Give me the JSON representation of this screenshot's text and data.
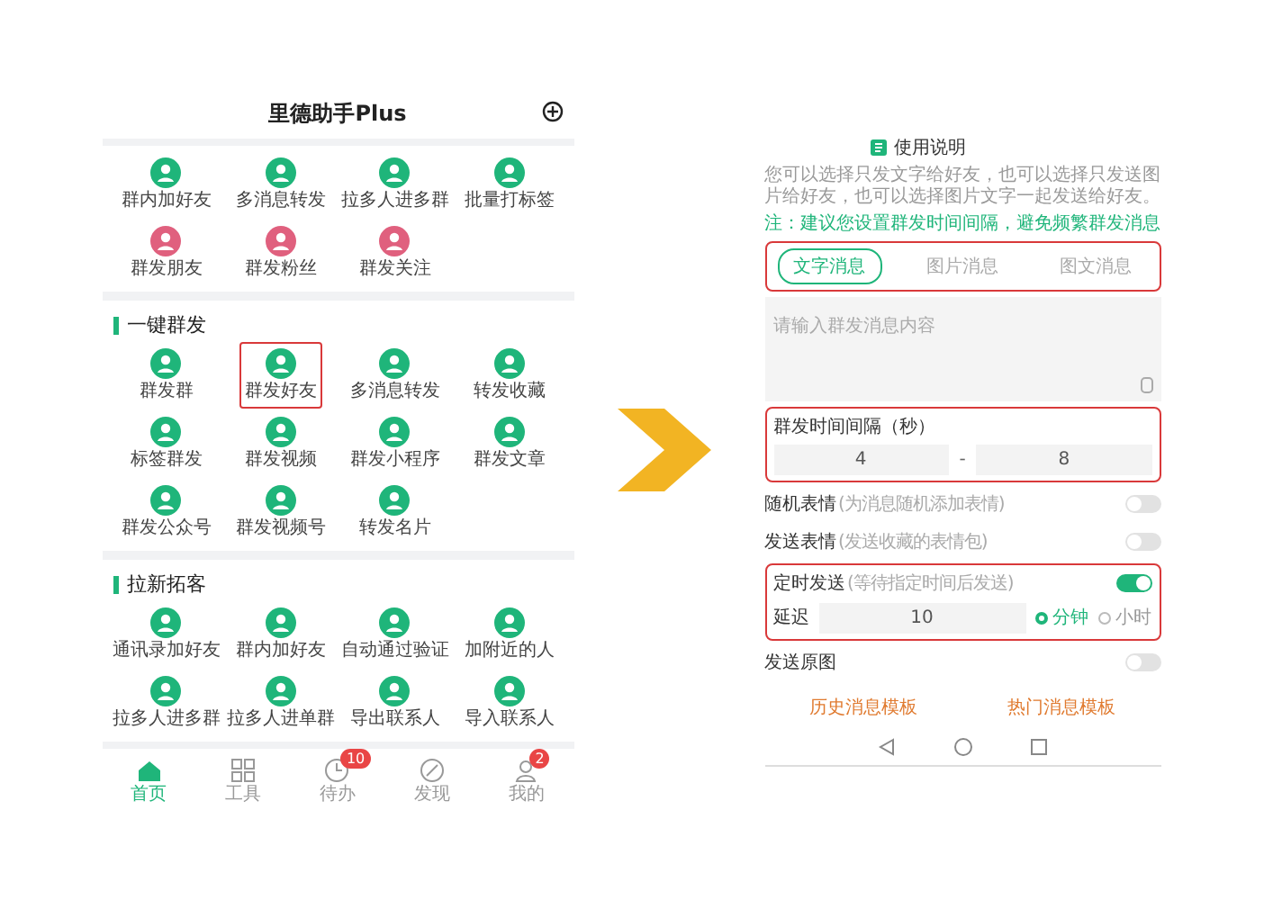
{
  "left_screen": {
    "title": "里德助手Plus",
    "sections": [
      {
        "items": [
          {
            "label": "群内加好友",
            "color": "#1fb57a",
            "highlighted": false
          },
          {
            "label": "多消息转发",
            "color": "#1fb57a",
            "highlighted": false
          },
          {
            "label": "拉多人进多群",
            "color": "#1fb57a",
            "highlighted": false
          },
          {
            "label": "批量打标签",
            "color": "#1fb57a",
            "highlighted": false
          },
          {
            "label": "群发朋友",
            "color": "#e0607e",
            "highlighted": false
          },
          {
            "label": "群发粉丝",
            "color": "#e0607e",
            "highlighted": false
          },
          {
            "label": "群发关注",
            "color": "#e0607e",
            "highlighted": false
          }
        ]
      },
      {
        "heading": "一键群发",
        "items": [
          {
            "label": "群发群",
            "color": "#1fb57a",
            "highlighted": false
          },
          {
            "label": "群发好友",
            "color": "#1fb57a",
            "highlighted": true
          },
          {
            "label": "多消息转发",
            "color": "#1fb57a",
            "highlighted": false
          },
          {
            "label": "转发收藏",
            "color": "#1fb57a",
            "highlighted": false
          },
          {
            "label": "标签群发",
            "color": "#1fb57a",
            "highlighted": false
          },
          {
            "label": "群发视频",
            "color": "#1fb57a",
            "highlighted": false
          },
          {
            "label": "群发小程序",
            "color": "#1fb57a",
            "highlighted": false
          },
          {
            "label": "群发文章",
            "color": "#1fb57a",
            "highlighted": false
          },
          {
            "label": "群发公众号",
            "color": "#1fb57a",
            "highlighted": false
          },
          {
            "label": "群发视频号",
            "color": "#1fb57a",
            "highlighted": false
          },
          {
            "label": "转发名片",
            "color": "#1fb57a",
            "highlighted": false
          }
        ]
      },
      {
        "heading": "拉新拓客",
        "items": [
          {
            "label": "通讯录加好友",
            "color": "#1fb57a",
            "highlighted": false
          },
          {
            "label": "群内加好友",
            "color": "#1fb57a",
            "highlighted": false
          },
          {
            "label": "自动通过验证",
            "color": "#1fb57a",
            "highlighted": false
          },
          {
            "label": "加附近的人",
            "color": "#1fb57a",
            "highlighted": false
          },
          {
            "label": "拉多人进多群",
            "color": "#1fb57a",
            "highlighted": false
          },
          {
            "label": "拉多人进单群",
            "color": "#1fb57a",
            "highlighted": false
          },
          {
            "label": "导出联系人",
            "color": "#1fb57a",
            "highlighted": false
          },
          {
            "label": "导入联系人",
            "color": "#1fb57a",
            "highlighted": false
          }
        ]
      }
    ],
    "nav": [
      {
        "label": "首页",
        "kind": "home",
        "selected": true
      },
      {
        "label": "工具",
        "kind": "grid",
        "selected": false
      },
      {
        "label": "待办",
        "kind": "clock",
        "selected": false,
        "badge": "10"
      },
      {
        "label": "发现",
        "kind": "compass",
        "selected": false
      },
      {
        "label": "我的",
        "kind": "person",
        "selected": false,
        "badge": "2"
      }
    ]
  },
  "right_screen": {
    "help_title": "使用说明",
    "description": "您可以选择只发文字给好友，也可以选择只发送图片给好友，也可以选择图片文字一起发送给好友。",
    "note": "注：建议您设置群发时间间隔，避免频繁群发消息",
    "message_tabs": {
      "highlighted": true,
      "tabs": [
        {
          "label": "文字消息",
          "selected": true
        },
        {
          "label": "图片消息",
          "selected": false
        },
        {
          "label": "图文消息",
          "selected": false
        }
      ]
    },
    "message_field": {
      "placeholder": "请输入群发消息内容"
    },
    "interval": {
      "label": "群发时间间隔（秒）",
      "highlighted": true,
      "from": "4",
      "separator": "-",
      "to": "8"
    },
    "toggles": [
      {
        "label": "随机表情",
        "hint": "(为消息随机添加表情)",
        "on": false
      },
      {
        "label": "发送表情",
        "hint": "(发送收藏的表情包)",
        "on": false
      }
    ],
    "timed_send": {
      "label": "定时发送",
      "hint": "(等待指定时间后发送)",
      "on": true,
      "highlighted": true,
      "delay_label": "延迟",
      "delay": "10",
      "units": [
        {
          "label": "分钟",
          "selected": true
        },
        {
          "label": "小时",
          "selected": false
        }
      ]
    },
    "toggles_after": [
      {
        "label": "发送原图",
        "on": false
      }
    ],
    "template_links": [
      "历史消息模板",
      "热门消息模板"
    ]
  }
}
